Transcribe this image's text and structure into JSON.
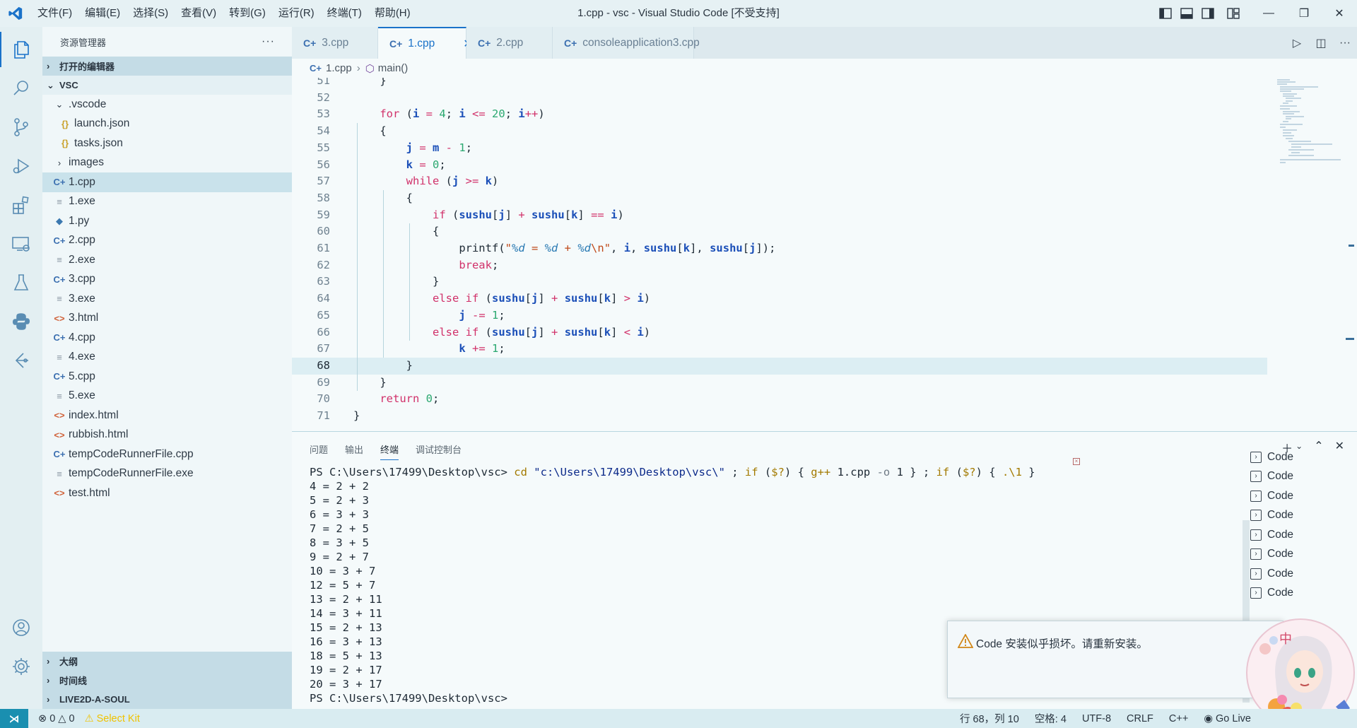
{
  "window": {
    "title": "1.cpp - vsc - Visual Studio Code [不受支持]",
    "menu": [
      "文件(F)",
      "编辑(E)",
      "选择(S)",
      "查看(V)",
      "转到(G)",
      "运行(R)",
      "终端(T)",
      "帮助(H)"
    ]
  },
  "sidebar": {
    "header": "资源管理器",
    "more": "···",
    "sections": {
      "open_editors": "打开的编辑器",
      "folder": "VSC",
      "outline": "大纲",
      "timeline": "时间线",
      "live2d": "LIVE2D-A-SOUL"
    },
    "tree": [
      {
        "name": ".vscode",
        "icon": "chevron-down",
        "indent": 1
      },
      {
        "name": "launch.json",
        "icon": "json",
        "indent": 2
      },
      {
        "name": "tasks.json",
        "icon": "json",
        "indent": 2
      },
      {
        "name": "images",
        "icon": "chevron-right",
        "indent": 1
      },
      {
        "name": "1.cpp",
        "icon": "cpp",
        "indent": 1,
        "selected": true
      },
      {
        "name": "1.exe",
        "icon": "exe",
        "indent": 1
      },
      {
        "name": "1.py",
        "icon": "py",
        "indent": 1
      },
      {
        "name": "2.cpp",
        "icon": "cpp",
        "indent": 1
      },
      {
        "name": "2.exe",
        "icon": "exe",
        "indent": 1
      },
      {
        "name": "3.cpp",
        "icon": "cpp",
        "indent": 1
      },
      {
        "name": "3.exe",
        "icon": "exe",
        "indent": 1
      },
      {
        "name": "3.html",
        "icon": "html",
        "indent": 1
      },
      {
        "name": "4.cpp",
        "icon": "cpp",
        "indent": 1
      },
      {
        "name": "4.exe",
        "icon": "exe",
        "indent": 1
      },
      {
        "name": "5.cpp",
        "icon": "cpp",
        "indent": 1
      },
      {
        "name": "5.exe",
        "icon": "exe",
        "indent": 1
      },
      {
        "name": "index.html",
        "icon": "html",
        "indent": 1
      },
      {
        "name": "rubbish.html",
        "icon": "html",
        "indent": 1
      },
      {
        "name": "tempCodeRunnerFile.cpp",
        "icon": "cpp",
        "indent": 1
      },
      {
        "name": "tempCodeRunnerFile.exe",
        "icon": "exe",
        "indent": 1
      },
      {
        "name": "test.html",
        "icon": "html",
        "indent": 1
      }
    ]
  },
  "tabs": [
    {
      "label": "3.cpp",
      "active": false
    },
    {
      "label": "1.cpp",
      "active": true
    },
    {
      "label": "2.cpp",
      "active": false
    },
    {
      "label": "consoleapplication3.cpp",
      "active": false
    }
  ],
  "breadcrumb": {
    "file": "1.cpp",
    "symbol": "main()"
  },
  "editor": {
    "current_line": 68,
    "lines": [
      {
        "n": 51,
        "tokens": [
          [
            "    ",
            "plain"
          ],
          [
            "}",
            "plain"
          ]
        ]
      },
      {
        "n": 52,
        "tokens": []
      },
      {
        "n": 53,
        "tokens": [
          [
            "    ",
            "plain"
          ],
          [
            "for",
            "kw"
          ],
          [
            " (",
            "plain"
          ],
          [
            "i",
            "var"
          ],
          [
            " = ",
            "op"
          ],
          [
            "4",
            "num"
          ],
          [
            "; ",
            "plain"
          ],
          [
            "i",
            "var"
          ],
          [
            " <= ",
            "op"
          ],
          [
            "20",
            "num"
          ],
          [
            "; ",
            "plain"
          ],
          [
            "i",
            "var"
          ],
          [
            "++",
            "op"
          ],
          [
            ")",
            "plain"
          ]
        ]
      },
      {
        "n": 54,
        "tokens": [
          [
            "    ",
            "plain"
          ],
          [
            "{",
            "plain"
          ]
        ]
      },
      {
        "n": 55,
        "tokens": [
          [
            "        ",
            "plain"
          ],
          [
            "j",
            "var"
          ],
          [
            " = ",
            "op"
          ],
          [
            "m",
            "var"
          ],
          [
            " - ",
            "op"
          ],
          [
            "1",
            "num"
          ],
          [
            ";",
            "plain"
          ]
        ]
      },
      {
        "n": 56,
        "tokens": [
          [
            "        ",
            "plain"
          ],
          [
            "k",
            "var"
          ],
          [
            " = ",
            "op"
          ],
          [
            "0",
            "num"
          ],
          [
            ";",
            "plain"
          ]
        ]
      },
      {
        "n": 57,
        "tokens": [
          [
            "        ",
            "plain"
          ],
          [
            "while",
            "kw"
          ],
          [
            " (",
            "plain"
          ],
          [
            "j",
            "var"
          ],
          [
            " >= ",
            "op"
          ],
          [
            "k",
            "var"
          ],
          [
            ")",
            "plain"
          ]
        ]
      },
      {
        "n": 58,
        "tokens": [
          [
            "        ",
            "plain"
          ],
          [
            "{",
            "plain"
          ]
        ]
      },
      {
        "n": 59,
        "tokens": [
          [
            "            ",
            "plain"
          ],
          [
            "if",
            "kw"
          ],
          [
            " (",
            "plain"
          ],
          [
            "sushu",
            "var"
          ],
          [
            "[",
            "plain"
          ],
          [
            "j",
            "var"
          ],
          [
            "] ",
            "plain"
          ],
          [
            "+",
            "op"
          ],
          [
            " ",
            "plain"
          ],
          [
            "sushu",
            "var"
          ],
          [
            "[",
            "plain"
          ],
          [
            "k",
            "var"
          ],
          [
            "] ",
            "plain"
          ],
          [
            "==",
            "op"
          ],
          [
            " ",
            "plain"
          ],
          [
            "i",
            "var"
          ],
          [
            ")",
            "plain"
          ]
        ]
      },
      {
        "n": 60,
        "tokens": [
          [
            "            ",
            "plain"
          ],
          [
            "{",
            "plain"
          ]
        ]
      },
      {
        "n": 61,
        "tokens": [
          [
            "                ",
            "plain"
          ],
          [
            "printf",
            "fn"
          ],
          [
            "(",
            "plain"
          ],
          [
            "\"",
            "str"
          ],
          [
            "%d",
            "fmt"
          ],
          [
            " = ",
            "str"
          ],
          [
            "%d",
            "fmt"
          ],
          [
            " + ",
            "str"
          ],
          [
            "%d",
            "fmt"
          ],
          [
            "\\n",
            "str"
          ],
          [
            "\"",
            "str"
          ],
          [
            ", ",
            "plain"
          ],
          [
            "i",
            "var"
          ],
          [
            ", ",
            "plain"
          ],
          [
            "sushu",
            "var"
          ],
          [
            "[",
            "plain"
          ],
          [
            "k",
            "var"
          ],
          [
            "], ",
            "plain"
          ],
          [
            "sushu",
            "var"
          ],
          [
            "[",
            "plain"
          ],
          [
            "j",
            "var"
          ],
          [
            "]);",
            "plain"
          ]
        ]
      },
      {
        "n": 62,
        "tokens": [
          [
            "                ",
            "plain"
          ],
          [
            "break",
            "kw"
          ],
          [
            ";",
            "plain"
          ]
        ]
      },
      {
        "n": 63,
        "tokens": [
          [
            "            ",
            "plain"
          ],
          [
            "}",
            "plain"
          ]
        ]
      },
      {
        "n": 64,
        "tokens": [
          [
            "            ",
            "plain"
          ],
          [
            "else",
            "kw"
          ],
          [
            " ",
            "plain"
          ],
          [
            "if",
            "kw"
          ],
          [
            " (",
            "plain"
          ],
          [
            "sushu",
            "var"
          ],
          [
            "[",
            "plain"
          ],
          [
            "j",
            "var"
          ],
          [
            "] ",
            "plain"
          ],
          [
            "+",
            "op"
          ],
          [
            " ",
            "plain"
          ],
          [
            "sushu",
            "var"
          ],
          [
            "[",
            "plain"
          ],
          [
            "k",
            "var"
          ],
          [
            "] ",
            "plain"
          ],
          [
            ">",
            "op"
          ],
          [
            " ",
            "plain"
          ],
          [
            "i",
            "var"
          ],
          [
            ")",
            "plain"
          ]
        ]
      },
      {
        "n": 65,
        "tokens": [
          [
            "                ",
            "plain"
          ],
          [
            "j",
            "var"
          ],
          [
            " -= ",
            "op"
          ],
          [
            "1",
            "num"
          ],
          [
            ";",
            "plain"
          ]
        ]
      },
      {
        "n": 66,
        "tokens": [
          [
            "            ",
            "plain"
          ],
          [
            "else",
            "kw"
          ],
          [
            " ",
            "plain"
          ],
          [
            "if",
            "kw"
          ],
          [
            " (",
            "plain"
          ],
          [
            "sushu",
            "var"
          ],
          [
            "[",
            "plain"
          ],
          [
            "j",
            "var"
          ],
          [
            "] ",
            "plain"
          ],
          [
            "+",
            "op"
          ],
          [
            " ",
            "plain"
          ],
          [
            "sushu",
            "var"
          ],
          [
            "[",
            "plain"
          ],
          [
            "k",
            "var"
          ],
          [
            "] ",
            "plain"
          ],
          [
            "<",
            "op"
          ],
          [
            " ",
            "plain"
          ],
          [
            "i",
            "var"
          ],
          [
            ")",
            "plain"
          ]
        ]
      },
      {
        "n": 67,
        "tokens": [
          [
            "                ",
            "plain"
          ],
          [
            "k",
            "var"
          ],
          [
            " += ",
            "op"
          ],
          [
            "1",
            "num"
          ],
          [
            ";",
            "plain"
          ]
        ]
      },
      {
        "n": 68,
        "tokens": [
          [
            "        ",
            "plain"
          ],
          [
            "}",
            "plain"
          ]
        ]
      },
      {
        "n": 69,
        "tokens": [
          [
            "    ",
            "plain"
          ],
          [
            "}",
            "plain"
          ]
        ]
      },
      {
        "n": 70,
        "tokens": [
          [
            "    ",
            "plain"
          ],
          [
            "return",
            "kw"
          ],
          [
            " ",
            "plain"
          ],
          [
            "0",
            "num"
          ],
          [
            ";",
            "plain"
          ]
        ]
      },
      {
        "n": 71,
        "tokens": [
          [
            "}",
            "plain"
          ]
        ]
      }
    ]
  },
  "panel": {
    "tabs": [
      "问题",
      "输出",
      "终端",
      "调试控制台"
    ],
    "active_tab": "终端",
    "terminal": {
      "prompt": "PS C:\\Users\\17499\\Desktop\\vsc>",
      "command": [
        [
          " cd ",
          "t-cmd"
        ],
        [
          "\"c:\\Users\\17499\\Desktop\\vsc\\\"",
          "t-str"
        ],
        [
          " ; ",
          "plain"
        ],
        [
          "if",
          "t-kw"
        ],
        [
          " (",
          "plain"
        ],
        [
          "$?",
          "t-kw"
        ],
        [
          ") { ",
          "plain"
        ],
        [
          "g++",
          "t-kw"
        ],
        [
          " 1.cpp ",
          "plain"
        ],
        [
          "-o",
          "t-op"
        ],
        [
          " 1 } ; ",
          "plain"
        ],
        [
          "if",
          "t-kw"
        ],
        [
          " (",
          "plain"
        ],
        [
          "$?",
          "t-kw"
        ],
        [
          ") { ",
          "plain"
        ],
        [
          ".\\1",
          "t-kw"
        ],
        [
          " }",
          "plain"
        ]
      ],
      "output": [
        "4 = 2 + 2",
        "5 = 2 + 3",
        "6 = 3 + 3",
        "7 = 2 + 5",
        "8 = 3 + 5",
        "9 = 2 + 7",
        "10 = 3 + 7",
        "12 = 5 + 7",
        "13 = 2 + 11",
        "14 = 3 + 11",
        "15 = 2 + 13",
        "16 = 3 + 13",
        "18 = 5 + 13",
        "19 = 2 + 17",
        "20 = 3 + 17"
      ],
      "final_prompt": "PS C:\\Users\\17499\\Desktop\\vsc>"
    },
    "terminal_list": [
      "Code",
      "Code",
      "Code",
      "Code",
      "Code",
      "Code",
      "Code",
      "Code",
      "Code"
    ]
  },
  "notification": {
    "message": "Code 安装似乎损坏。请重新安装。"
  },
  "statusbar": {
    "errors": "0",
    "warnings": "0",
    "kit": "Select Kit",
    "position": "行 68，列 10",
    "spaces": "空格: 4",
    "encoding": "UTF-8",
    "eol": "CRLF",
    "language": "C++",
    "golive": "Go Live"
  }
}
